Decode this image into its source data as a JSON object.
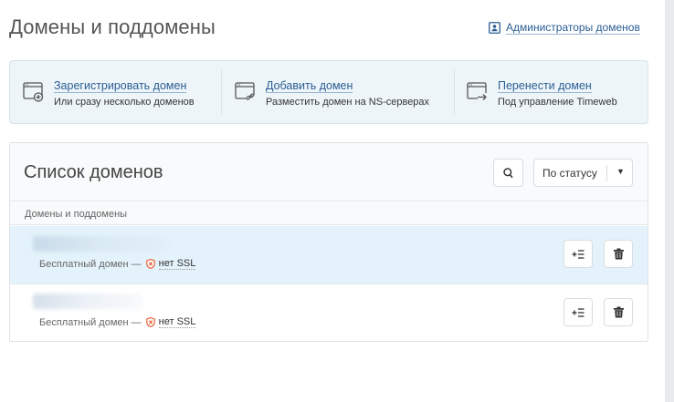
{
  "header": {
    "title": "Домены и поддомены",
    "admins_link": "Администраторы доменов"
  },
  "actions": [
    {
      "title": "Зарегистрировать домен",
      "subtitle": "Или сразу несколько доменов",
      "icon": "browser-plus-icon"
    },
    {
      "title": "Добавить домен",
      "subtitle": "Разместить домен на NS-серверах",
      "icon": "browser-link-icon"
    },
    {
      "title": "Перенести домен",
      "subtitle": "Под управление Timeweb",
      "icon": "browser-transfer-icon"
    }
  ],
  "domains_list": {
    "title": "Список доменов",
    "search_icon": "search-icon",
    "status_filter": "По статусу",
    "column_header": "Домены и поддомены",
    "rows": [
      {
        "type": "Бесплатный домен —",
        "ssl": "нет SSL",
        "selected": true
      },
      {
        "type": "Бесплатный домен —",
        "ssl": "нет SSL",
        "selected": false
      }
    ]
  },
  "colors": {
    "link": "#2a5d93",
    "panel_bg": "#eef5f9",
    "selected_row": "#e4f3fb",
    "ssl_shield": "#e8562a"
  }
}
